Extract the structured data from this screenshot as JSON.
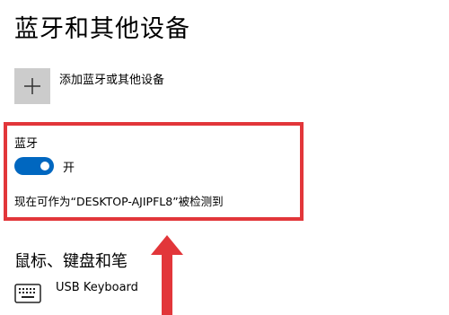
{
  "page": {
    "title": "蓝牙和其他设备"
  },
  "add_device": {
    "label": "添加蓝牙或其他设备",
    "icon": "plus-icon"
  },
  "bluetooth": {
    "heading": "蓝牙",
    "toggle_state": "开",
    "toggle_on": true,
    "discoverable_text": "现在可作为“DESKTOP-AJIPFL8”被检测到"
  },
  "mouse_keyboard_pen": {
    "heading": "鼠标、键盘和笔",
    "devices": [
      {
        "name": "USB Keyboard",
        "icon": "keyboard-icon"
      }
    ]
  },
  "colors": {
    "accent": "#0067c0",
    "highlight_red": "#e2363a",
    "tile_gray": "#cccccc"
  }
}
